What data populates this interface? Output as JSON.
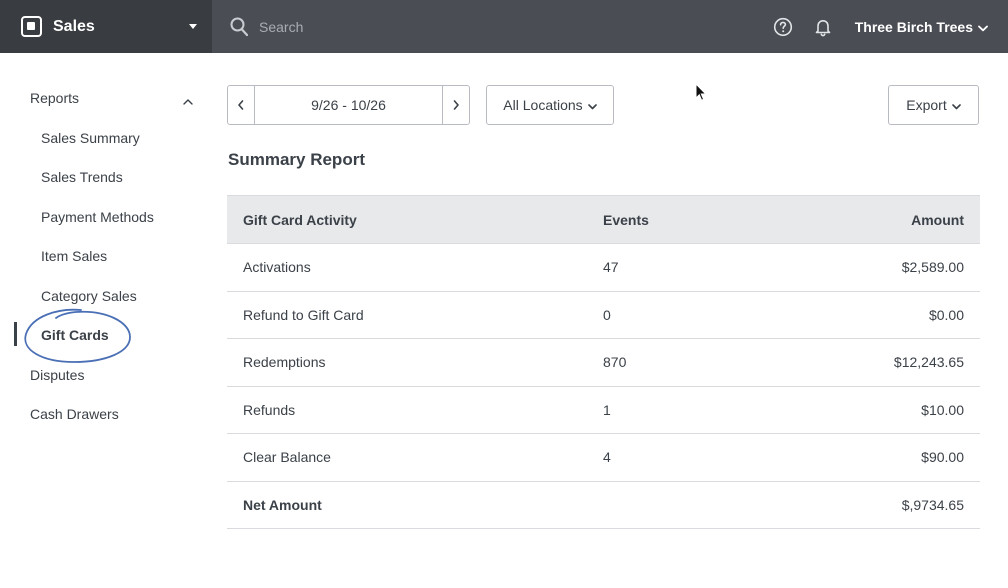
{
  "app": {
    "name": "Sales",
    "search_placeholder": "Search",
    "account_name": "Three Birch Trees"
  },
  "sidebar": {
    "section": "Reports",
    "items": [
      {
        "label": "Sales Summary"
      },
      {
        "label": "Sales Trends"
      },
      {
        "label": "Payment Methods"
      },
      {
        "label": "Item Sales"
      },
      {
        "label": "Category Sales"
      },
      {
        "label": "Gift Cards",
        "active": true
      }
    ],
    "other_items": [
      {
        "label": "Disputes"
      },
      {
        "label": "Cash Drawers"
      }
    ]
  },
  "controls": {
    "date_range": "9/26 - 10/26",
    "locations": "All Locations",
    "export": "Export"
  },
  "report": {
    "title": "Summary Report",
    "columns": [
      "Gift Card Activity",
      "Events",
      "Amount"
    ],
    "rows": [
      {
        "activity": "Activations",
        "events": "47",
        "amount": "$2,589.00"
      },
      {
        "activity": "Refund to Gift Card",
        "events": "0",
        "amount": "$0.00"
      },
      {
        "activity": "Redemptions",
        "events": "870",
        "amount": "$12,243.65"
      },
      {
        "activity": "Refunds",
        "events": "1",
        "amount": "$10.00"
      },
      {
        "activity": "Clear Balance",
        "events": "4",
        "amount": "$90.00"
      }
    ],
    "total": {
      "activity": "Net Amount",
      "events": "",
      "amount": "$,9734.65"
    }
  },
  "icons": {
    "brand": "square-logo-icon",
    "search": "search-icon",
    "help": "help-circle-icon",
    "notifications": "bell-icon",
    "prev": "chevron-left-icon",
    "next": "chevron-right-icon"
  },
  "colors": {
    "topbar": "#4a4e54",
    "brand_bg": "#393c40",
    "annotation_circle": "#4a6fb5"
  }
}
